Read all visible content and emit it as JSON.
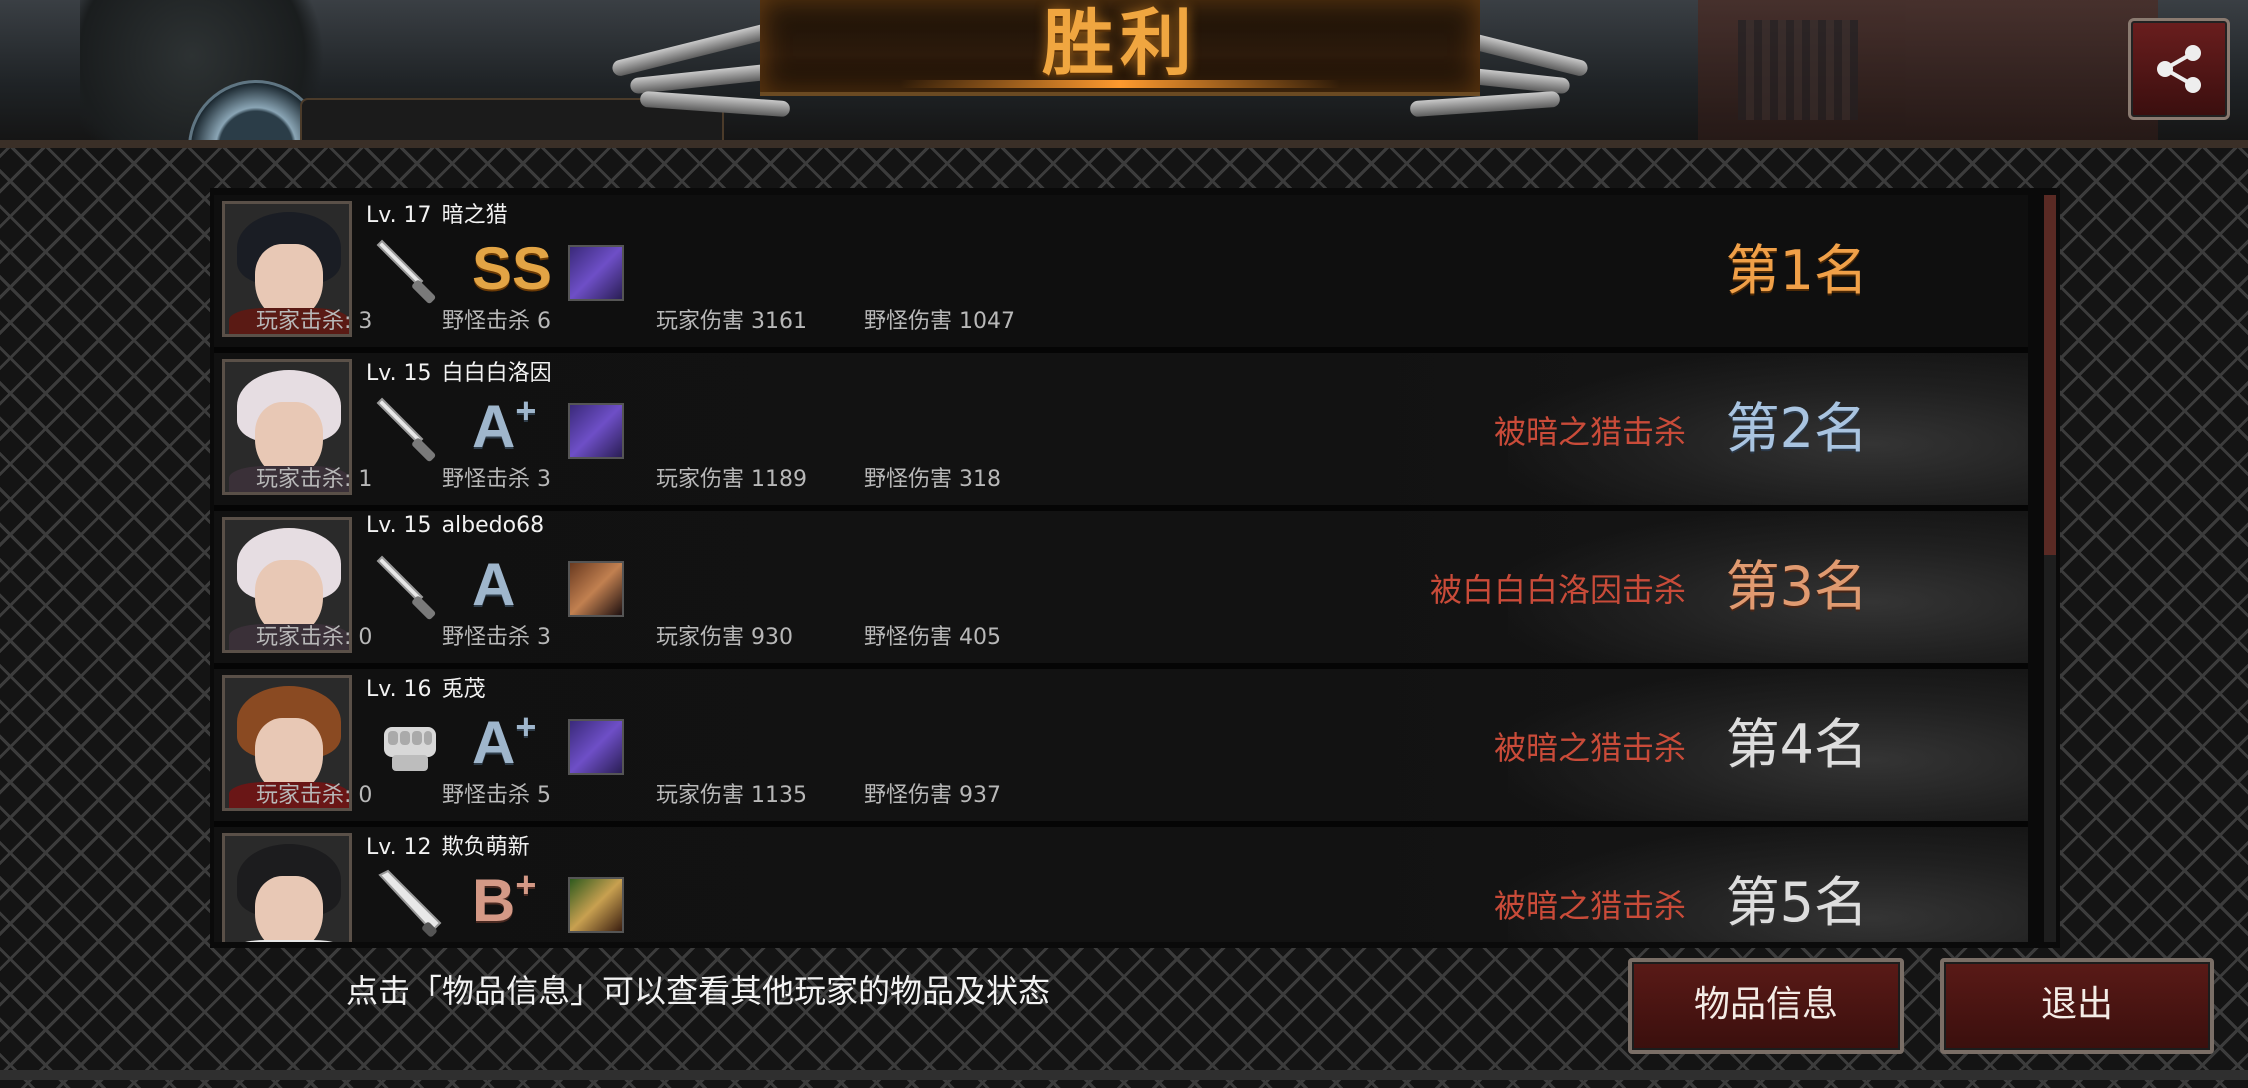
{
  "header": {
    "title": "胜利",
    "share_icon": "share-icon"
  },
  "players": [
    {
      "level": "Lv. 17",
      "name": "暗之猎",
      "weapon": "knife-icon",
      "grade": "SS",
      "grade_plus": "",
      "grade_style": "gold",
      "item_style": "purple",
      "player_kills": "玩家击杀: 3",
      "monster_kills": "野怪击杀 6",
      "player_damage": "玩家伤害 3161",
      "monster_damage": "野怪伤害 1047",
      "killed_by": "",
      "rank": "第1名",
      "rank_style": "r1",
      "hair": "#1a1d24",
      "body": "#5a1a14"
    },
    {
      "level": "Lv. 15",
      "name": "白白白洛因",
      "weapon": "knife-icon",
      "grade": "A",
      "grade_plus": "+",
      "grade_style": "silver",
      "item_style": "purple",
      "player_kills": "玩家击杀: 1",
      "monster_kills": "野怪击杀 3",
      "player_damage": "玩家伤害 1189",
      "monster_damage": "野怪伤害 318",
      "killed_by": "被暗之猎击杀",
      "rank": "第2名",
      "rank_style": "r2",
      "hair": "#e6dde2",
      "body": "#3a3038"
    },
    {
      "level": "Lv. 15",
      "name": "albedo68",
      "weapon": "knife-icon",
      "grade": "A",
      "grade_plus": "",
      "grade_style": "silver",
      "item_style": "pilot",
      "player_kills": "玩家击杀: 0",
      "monster_kills": "野怪击杀 3",
      "player_damage": "玩家伤害 930",
      "monster_damage": "野怪伤害 405",
      "killed_by": "被白白白洛因击杀",
      "rank": "第3名",
      "rank_style": "r3",
      "hair": "#e6dde2",
      "body": "#3a3038"
    },
    {
      "level": "Lv. 16",
      "name": "兎茂",
      "weapon": "fist-icon",
      "grade": "A",
      "grade_plus": "+",
      "grade_style": "silver",
      "item_style": "purple",
      "player_kills": "玩家击杀: 0",
      "monster_kills": "野怪击杀 5",
      "player_damage": "玩家伤害 1135",
      "monster_damage": "野怪伤害 937",
      "killed_by": "被暗之猎击杀",
      "rank": "第4名",
      "rank_style": "rn",
      "hair": "#8a4a22",
      "body": "#6a1616"
    },
    {
      "level": "Lv. 12",
      "name": "欺负萌新",
      "weapon": "bat-icon",
      "grade": "B",
      "grade_plus": "+",
      "grade_style": "copper",
      "item_style": "green",
      "player_kills": "",
      "monster_kills": "",
      "player_damage": "",
      "monster_damage": "",
      "killed_by": "被暗之猎击杀",
      "rank": "第5名",
      "rank_style": "rn",
      "hair": "#1c1c1e",
      "body": "#e8e8e8"
    }
  ],
  "footer": {
    "hint": "点击「物品信息」可以查看其他玩家的物品及状态",
    "items_button": "物品信息",
    "exit_button": "退出"
  }
}
